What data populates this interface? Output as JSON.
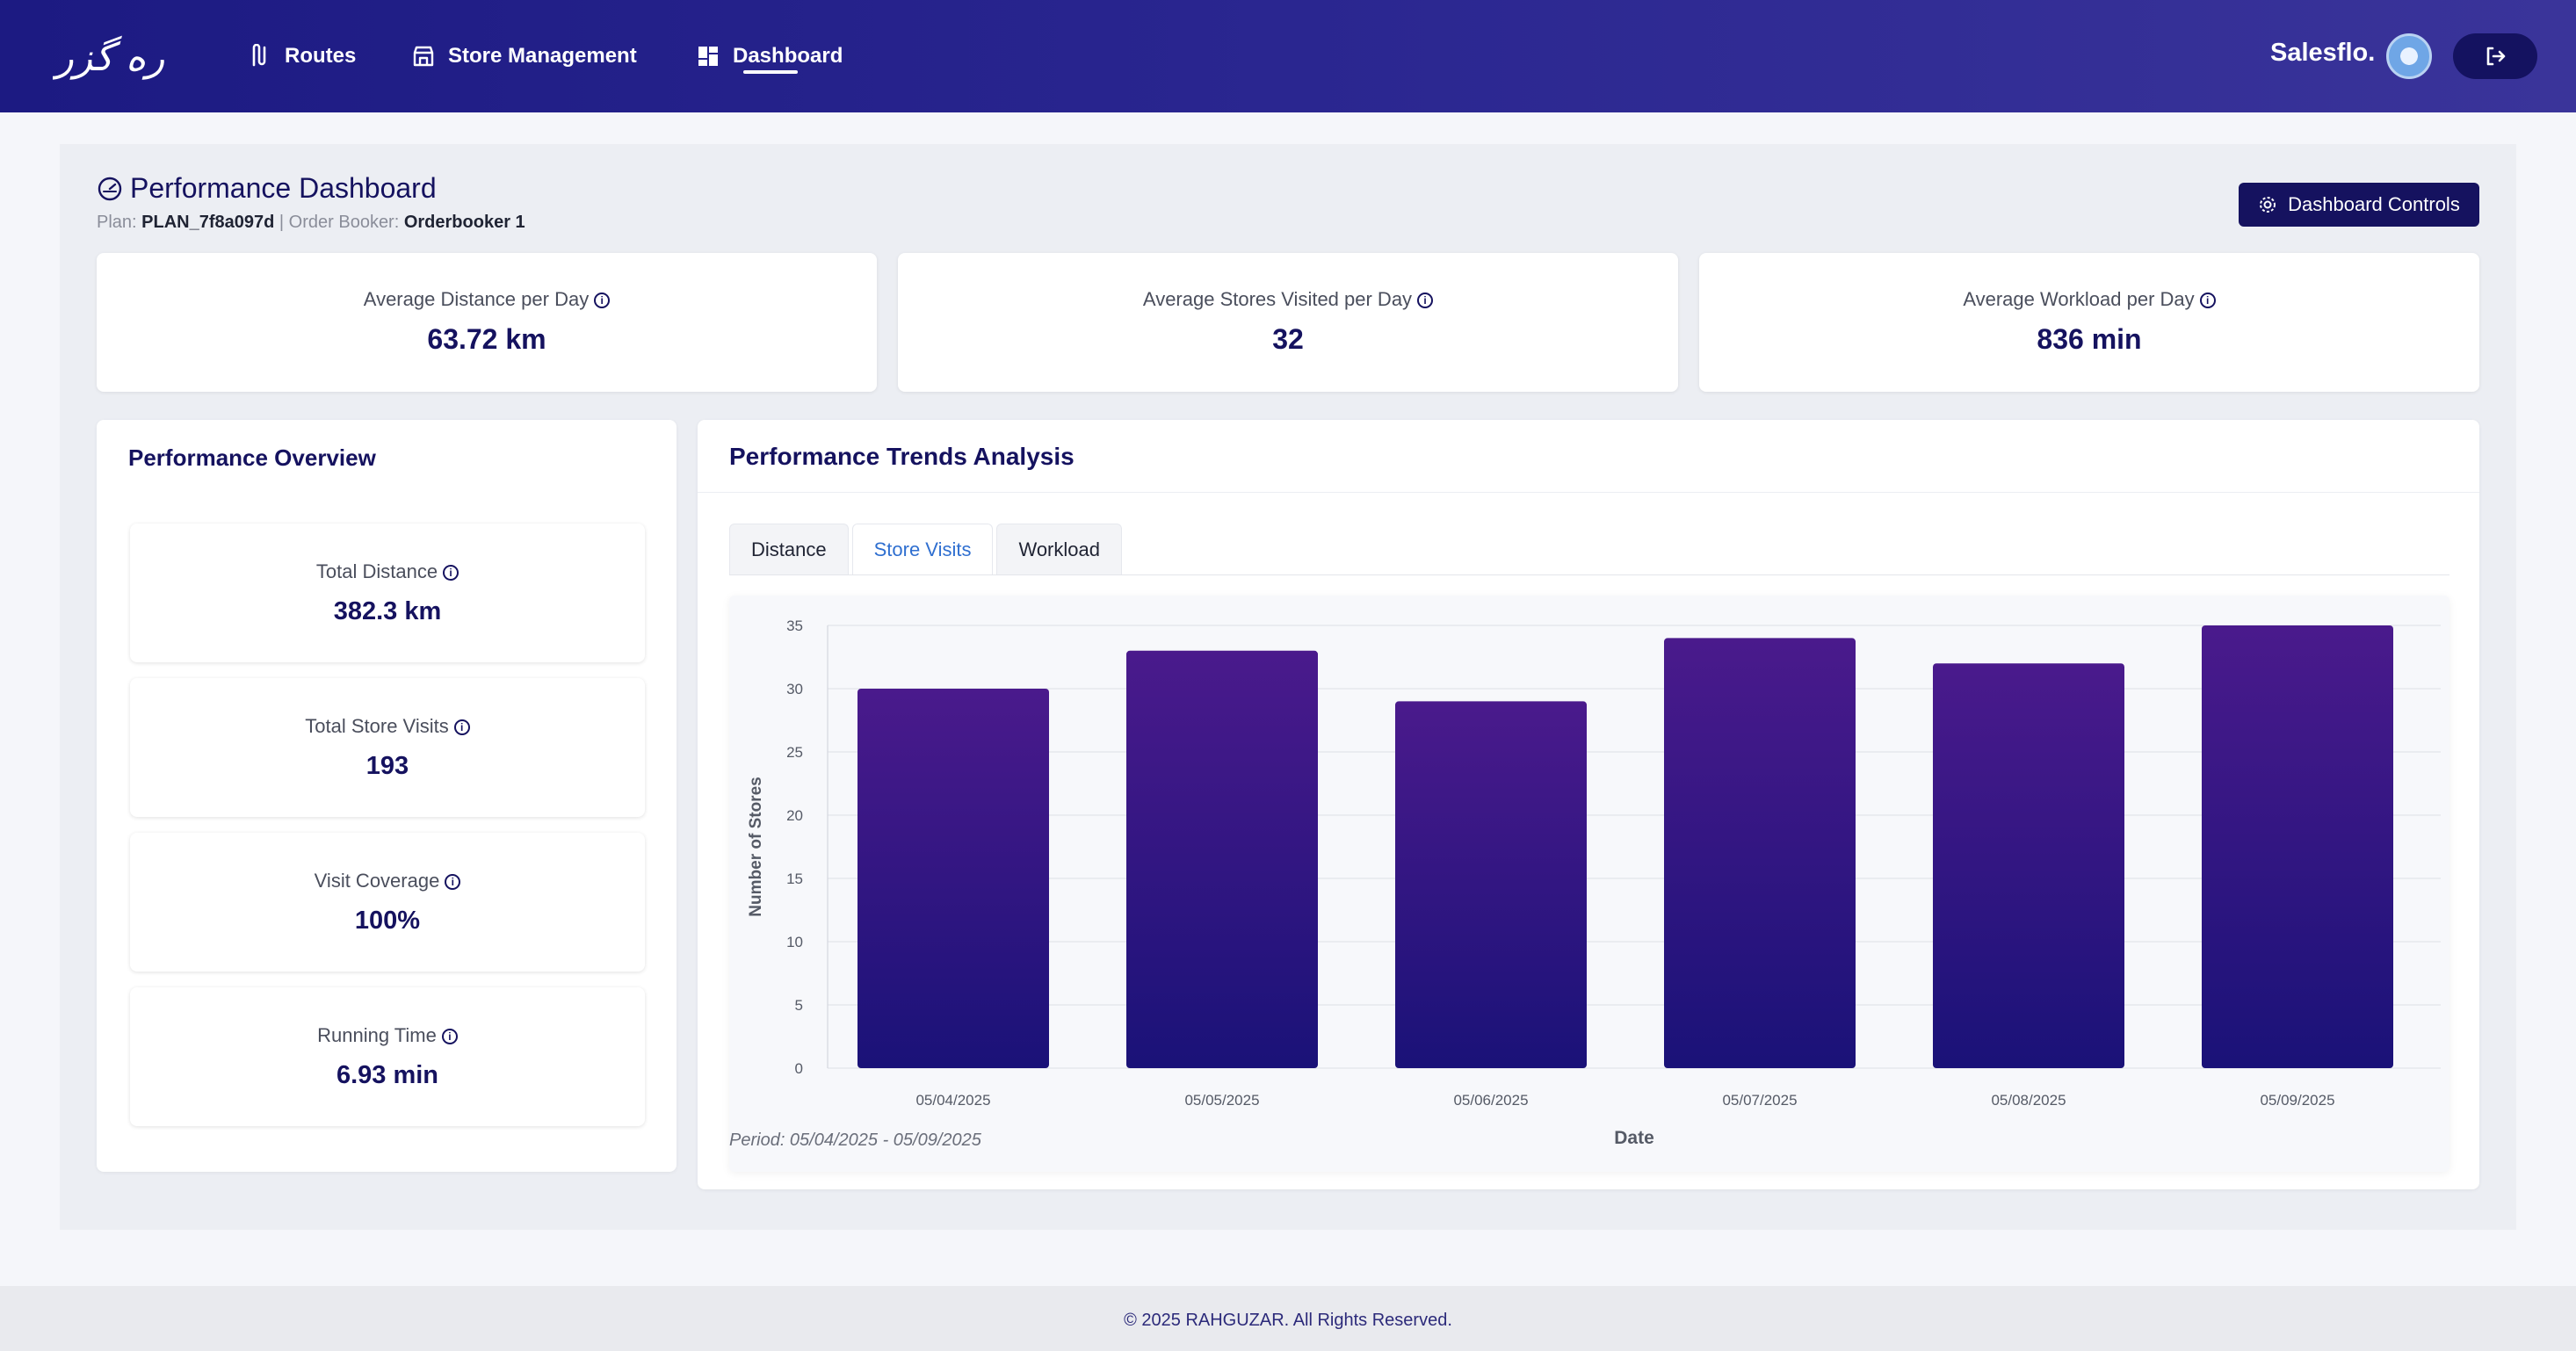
{
  "nav": {
    "items": [
      {
        "label": "Routes",
        "icon": "route-icon"
      },
      {
        "label": "Store Management",
        "icon": "store-icon"
      },
      {
        "label": "Dashboard",
        "icon": "dashboard-icon"
      }
    ],
    "active": "Dashboard",
    "brand": "Salesflo.",
    "logo_text": "ره گزر"
  },
  "header": {
    "title": "Performance Dashboard",
    "plan_label": "Plan:",
    "plan_value": "PLAN_7f8a097d",
    "separator": "|",
    "booker_label": "Order Booker:",
    "booker_value": "Orderbooker 1",
    "controls_label": "Dashboard Controls"
  },
  "stats": [
    {
      "label": "Average Distance per Day",
      "value": "63.72 km"
    },
    {
      "label": "Average Stores Visited per Day",
      "value": "32"
    },
    {
      "label": "Average Workload per Day",
      "value": "836 min"
    }
  ],
  "overview": {
    "title": "Performance Overview",
    "items": [
      {
        "label": "Total Distance",
        "value": "382.3 km"
      },
      {
        "label": "Total Store Visits",
        "value": "193"
      },
      {
        "label": "Visit Coverage",
        "value": "100%"
      },
      {
        "label": "Running Time",
        "value": "6.93 min"
      }
    ]
  },
  "trends": {
    "title": "Performance Trends Analysis",
    "tabs": [
      "Distance",
      "Store Visits",
      "Workload"
    ],
    "active_tab": "Store Visits",
    "period": "Period: 05/04/2025 - 05/09/2025"
  },
  "chart_data": {
    "type": "bar",
    "categories": [
      "05/04/2025",
      "05/05/2025",
      "05/06/2025",
      "05/07/2025",
      "05/08/2025",
      "05/09/2025"
    ],
    "values": [
      30,
      33,
      29,
      34,
      32,
      35
    ],
    "xlabel": "Date",
    "ylabel": "Number of Stores",
    "ylim": [
      0,
      35
    ],
    "yticks": [
      0,
      5,
      10,
      15,
      20,
      25,
      30,
      35
    ],
    "grid": true,
    "bar_color_top": "#4a1a8c",
    "bar_color_bottom": "#1a1278"
  },
  "footer": {
    "text": "© 2025 RAHGUZAR. All Rights Reserved."
  }
}
